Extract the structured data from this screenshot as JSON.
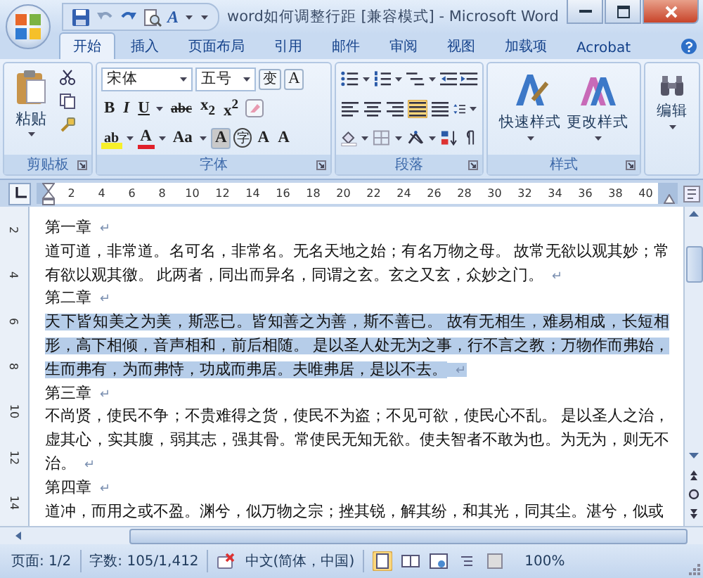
{
  "window": {
    "title": "word如何调整行距 [兼容模式] - Microsoft Word"
  },
  "quick_access": {
    "text_effect": "A"
  },
  "tabs": [
    {
      "label": "开始",
      "selected": true
    },
    {
      "label": "插入",
      "selected": false
    },
    {
      "label": "页面布局",
      "selected": false
    },
    {
      "label": "引用",
      "selected": false
    },
    {
      "label": "邮件",
      "selected": false
    },
    {
      "label": "审阅",
      "selected": false
    },
    {
      "label": "视图",
      "selected": false
    },
    {
      "label": "加载项",
      "selected": false
    },
    {
      "label": "Acrobat",
      "selected": false
    }
  ],
  "clipboard": {
    "paste": "粘贴",
    "group_label": "剪贴板"
  },
  "font": {
    "name": "宋体",
    "size": "五号",
    "phonetic": "变",
    "border": "A",
    "bold": "B",
    "italic": "I",
    "underline": "U",
    "strikethrough": "abc",
    "subscript": "x$_{2}$",
    "superscript": "x$^{2}$",
    "highlight": "ab",
    "font_color": "A",
    "change_case": "Aa",
    "shading": "A",
    "enclose": "字",
    "grow": "A",
    "shrink": "A",
    "group_label": "字体"
  },
  "paragraph": {
    "alignments": [
      {
        "kind": "left",
        "selected": false
      },
      {
        "kind": "center",
        "selected": false
      },
      {
        "kind": "right",
        "selected": false
      },
      {
        "kind": "justify",
        "selected": true
      },
      {
        "kind": "distributed",
        "selected": false
      }
    ],
    "group_label": "段落"
  },
  "styles": {
    "quick": "快速样式",
    "change": "更改样式",
    "group_label": "样式"
  },
  "editing": {
    "label": "编辑"
  },
  "ruler": {
    "ticks": [
      "2",
      "4",
      "6",
      "8",
      "10",
      "12",
      "14",
      "16",
      "18",
      "20",
      "22",
      "24",
      "26",
      "28",
      "30",
      "32",
      "34",
      "36",
      "38",
      "40"
    ]
  },
  "vertical_ruler": {
    "ticks": [
      "2",
      "4",
      "6",
      "8",
      "10",
      "12",
      "14"
    ]
  },
  "document": {
    "paragraphs": [
      {
        "text": "第一章",
        "mark": "↵",
        "selected": false
      },
      {
        "text": "道可道，非常道。名可名，非常名。无名天地之始；有名万物之母。 故常无欲以观其妙；常有欲以观其徼。 此两者，同出而异名，同谓之玄。玄之又玄，众妙之门。",
        "mark": "↵",
        "selected": false
      },
      {
        "text": "第二章",
        "mark": "↵",
        "selected": false
      },
      {
        "text": "天下皆知美之为美，斯恶已。皆知善之为善，斯不善已。 故有无相生，难易相成，长短相形，高下相倾，音声相和，前后相随。 是以圣人处无为之事，行不言之教；万物作而弗始，生而弗有，为而弗恃，功成而弗居。夫唯弗居，是以不去。",
        "mark": "↵",
        "selected": true
      },
      {
        "text": "第三章",
        "mark": "↵",
        "selected": false
      },
      {
        "text": "不尚贤，使民不争；不贵难得之货，使民不为盗；不见可欲，使民心不乱。 是以圣人之治，虚其心，实其腹，弱其志，强其骨。常使民无知无欲。使夫智者不敢为也。为无为，则无不治。",
        "mark": "↵",
        "selected": false
      },
      {
        "text": "第四章",
        "mark": "↵",
        "selected": false
      },
      {
        "text": "道冲，而用之或不盈。渊兮，似万物之宗；挫其锐，解其纷，和其光，同其尘。湛兮，似或",
        "selected": false
      }
    ]
  },
  "status_bar": {
    "page": "页面: 1/2",
    "words": "字数: 105/1,412",
    "language": "中文(简体，中国)",
    "views": [
      {
        "kind": "print",
        "selected": true
      },
      {
        "kind": "reading",
        "selected": false
      },
      {
        "kind": "web",
        "selected": false
      },
      {
        "kind": "outline",
        "selected": false
      },
      {
        "kind": "draft",
        "selected": false
      }
    ],
    "zoom": "100%"
  }
}
